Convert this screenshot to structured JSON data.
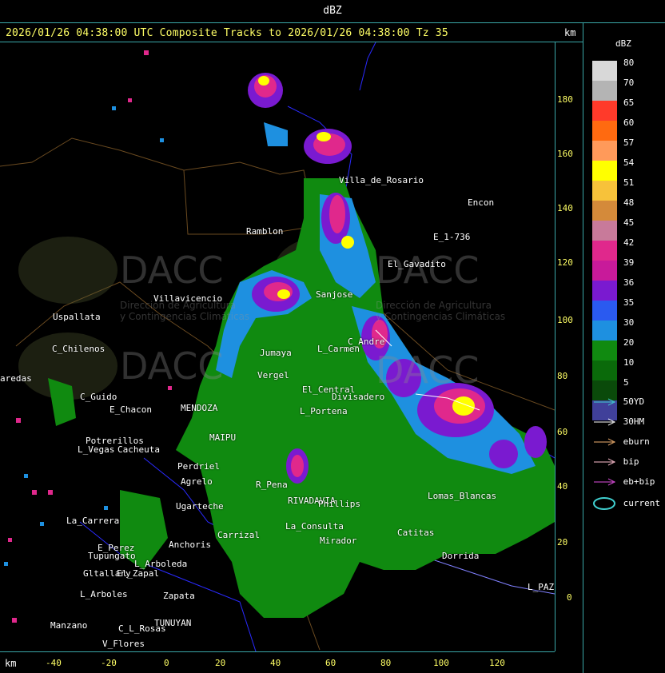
{
  "units_title": "dBZ",
  "title": "2026/01/26 04:38:00 UTC Composite Tracks to 2026/01/26 04:38:00 Tz 35",
  "axis_unit": "km",
  "legend": {
    "title": "dBZ",
    "levels": [
      {
        "label": "80",
        "color": "#d8d8d8"
      },
      {
        "label": "70",
        "color": "#b4b4b4"
      },
      {
        "label": "65",
        "color": "#ff3a2a"
      },
      {
        "label": "60",
        "color": "#ff6a10"
      },
      {
        "label": "57",
        "color": "#ff9a5a"
      },
      {
        "label": "54",
        "color": "#ffff00"
      },
      {
        "label": "51",
        "color": "#f7c23a"
      },
      {
        "label": "48",
        "color": "#d48a3a"
      },
      {
        "label": "45",
        "color": "#c87a9a"
      },
      {
        "label": "42",
        "color": "#e0288c"
      },
      {
        "label": "39",
        "color": "#c81a9a"
      },
      {
        "label": "36",
        "color": "#7a1ad0"
      },
      {
        "label": "35",
        "color": "#2a5af0"
      },
      {
        "label": "30",
        "color": "#1e90e0"
      },
      {
        "label": "20",
        "color": "#108a10"
      },
      {
        "label": "10",
        "color": "#0a6a0a"
      },
      {
        "label": "5",
        "color": "#0a4a0a"
      },
      {
        "label": "",
        "color": "#40409a"
      }
    ]
  },
  "tracks": [
    {
      "label": "50YD",
      "color": "#40d0d0"
    },
    {
      "label": "30HM",
      "color": "#ffffff"
    },
    {
      "label": "eburn",
      "color": "#f0b070"
    },
    {
      "label": "bip",
      "color": "#ffc0d0"
    },
    {
      "label": "eb+bip",
      "color": "#e050e0"
    },
    {
      "label": "current",
      "color": "#40d0d0"
    }
  ],
  "y_ticks": [
    "180",
    "160",
    "140",
    "120",
    "100",
    "80",
    "60",
    "40",
    "20",
    "0"
  ],
  "x_ticks": [
    "-40",
    "-20",
    "0",
    "20",
    "40",
    "60",
    "80",
    "100",
    "120"
  ],
  "places": [
    {
      "name": "Uspallata"
    },
    {
      "name": "C_Chilenos"
    },
    {
      "name": "aredas"
    },
    {
      "name": "C_Guido"
    },
    {
      "name": "E_Chacon"
    },
    {
      "name": "Potrerillos"
    },
    {
      "name": "L_Vegas"
    },
    {
      "name": "Cacheuta"
    },
    {
      "name": "La_Carrera"
    },
    {
      "name": "E_Perez"
    },
    {
      "name": "Tupungato"
    },
    {
      "name": "Gltallary"
    },
    {
      "name": "L_Arboles"
    },
    {
      "name": "Manzano"
    },
    {
      "name": "V_Flores"
    },
    {
      "name": "Ramblon"
    },
    {
      "name": "Villavicencio"
    },
    {
      "name": "Villa_de_Rosario"
    },
    {
      "name": "Encon"
    },
    {
      "name": "E_1-736"
    },
    {
      "name": "El_Gavadito"
    },
    {
      "name": "Sanjose"
    },
    {
      "name": "Jumaya"
    },
    {
      "name": "L_Carmen"
    },
    {
      "name": "C_Andre"
    },
    {
      "name": "Vergel"
    },
    {
      "name": "El_Central"
    },
    {
      "name": "Divisadero"
    },
    {
      "name": "L_Portena"
    },
    {
      "name": "MENDOZA"
    },
    {
      "name": "MAIPU"
    },
    {
      "name": "Perdriel"
    },
    {
      "name": "Agrelo"
    },
    {
      "name": "Ugarteche"
    },
    {
      "name": "Carrizal"
    },
    {
      "name": "R_Pena"
    },
    {
      "name": "RIVADAVIA"
    },
    {
      "name": "Phillips"
    },
    {
      "name": "Lomas_Blancas"
    },
    {
      "name": "Catitas"
    },
    {
      "name": "Dorrida"
    },
    {
      "name": "L_PAZ"
    },
    {
      "name": "Anchoris"
    },
    {
      "name": "El_Zapal"
    },
    {
      "name": "L_Arboleda"
    },
    {
      "name": "Zapata"
    },
    {
      "name": "TUNUYAN"
    },
    {
      "name": "C_L_Rosas"
    },
    {
      "name": "La_Consulta"
    },
    {
      "name": "Mirador"
    }
  ],
  "watermarks": [
    {
      "text": "DACC",
      "sub1": "Dirección de Agricultura",
      "sub2": "y Contingencias Climáticas"
    },
    {
      "text": "DACC",
      "sub1": "Dirección de Agricultura",
      "sub2": "y Contingencias Climáticas"
    },
    {
      "text": "DACC",
      "sub1": "",
      "sub2": ""
    },
    {
      "text": "DACC",
      "sub1": "",
      "sub2": ""
    }
  ]
}
